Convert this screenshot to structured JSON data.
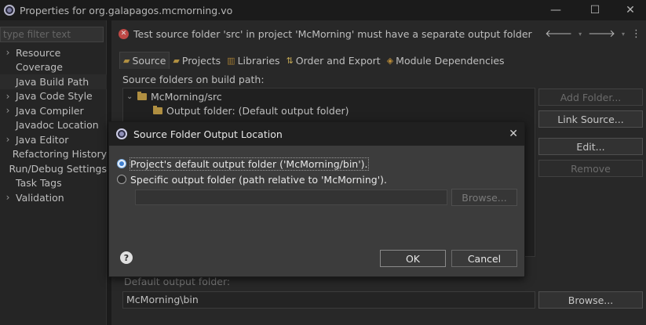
{
  "window": {
    "title": "Properties for org.galapagos.mcmorning.vo",
    "minimize_glyph": "—",
    "maximize_glyph": "☐",
    "close_glyph": "✕"
  },
  "sidebar": {
    "filter_placeholder": "type filter text",
    "items": [
      {
        "label": "Resource",
        "expandable": true
      },
      {
        "label": "Coverage",
        "expandable": false
      },
      {
        "label": "Java Build Path",
        "expandable": false,
        "selected": true
      },
      {
        "label": "Java Code Style",
        "expandable": true
      },
      {
        "label": "Java Compiler",
        "expandable": true
      },
      {
        "label": "Javadoc Location",
        "expandable": false
      },
      {
        "label": "Java Editor",
        "expandable": true
      },
      {
        "label": "Refactoring History",
        "expandable": false
      },
      {
        "label": "Run/Debug Settings",
        "expandable": false
      },
      {
        "label": "Task Tags",
        "expandable": false
      },
      {
        "label": "Validation",
        "expandable": true
      }
    ]
  },
  "main": {
    "error_message": "Test source folder 'src' in project 'McMorning' must have a separate output folder",
    "tabs": [
      {
        "label": "Source",
        "icon": "source-icon",
        "active": true
      },
      {
        "label": "Projects",
        "icon": "projects-icon"
      },
      {
        "label": "Libraries",
        "icon": "libraries-icon"
      },
      {
        "label": "Order and Export",
        "icon": "order-export-icon"
      },
      {
        "label": "Module Dependencies",
        "icon": "module-icon"
      }
    ],
    "source_folders_label": "Source folders on build path:",
    "tree": {
      "root": "McMorning/src",
      "child": "Output folder: (Default output folder)"
    },
    "buttons": {
      "add_folder": "Add Folder...",
      "link_source": "Link Source...",
      "edit": "Edit...",
      "remove": "Remove"
    },
    "default_output_label": "Default output folder:",
    "default_output_value": "McMorning\\bin",
    "browse": "Browse..."
  },
  "dialog": {
    "title": "Source Folder Output Location",
    "option_default": "Project's default output folder ('McMorning/bin').",
    "option_specific": "Specific output folder (path relative to 'McMorning').",
    "browse": "Browse...",
    "ok": "OK",
    "cancel": "Cancel",
    "help_glyph": "?"
  }
}
